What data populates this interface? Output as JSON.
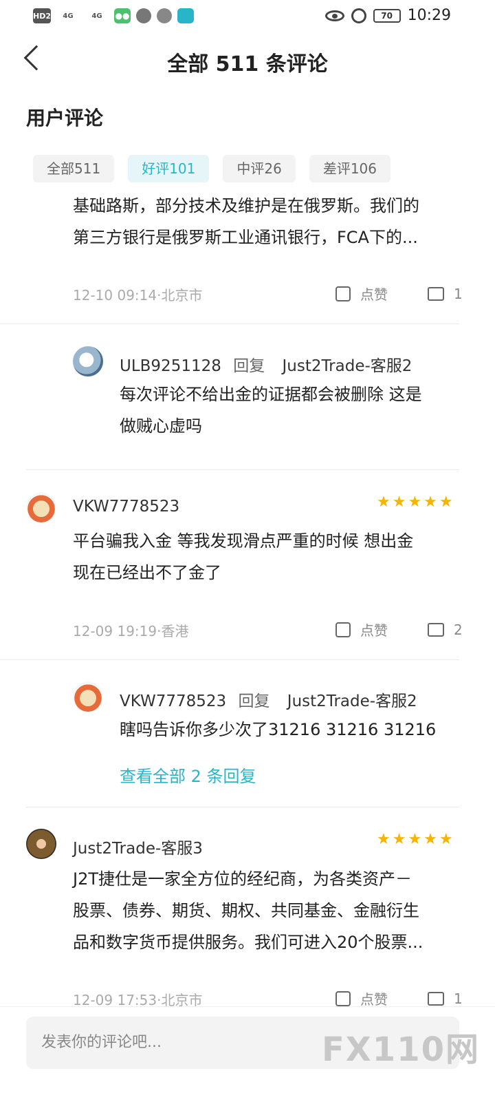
{
  "status_bar": {
    "left": {
      "hd": "HD2",
      "sig1": "4G",
      "sig2": "4G"
    },
    "battery": "70",
    "time": "10:29"
  },
  "header": {
    "title": "全部 511 条评论"
  },
  "section": {
    "title": "用户评论"
  },
  "tabs": [
    {
      "label": "全部511"
    },
    {
      "label": "好评101",
      "active": true
    },
    {
      "label": "中评26"
    },
    {
      "label": "差评106"
    }
  ],
  "comment0": {
    "text_line1": "基础路斯，部分技术及维护是在俄罗斯。我们的",
    "text_line2": "第三方银行是俄罗斯工业通讯银行，FCA下的...",
    "meta": "12-10 09:14·北京市",
    "like_label": "点赞",
    "reply_count": "1"
  },
  "reply1": {
    "user": "ULB9251128",
    "reply_word": "回复",
    "target": "Just2Trade-客服2",
    "text_line1": "每次评论不给出金的证据都会被删除 这是",
    "text_line2": "做贼心虚吗"
  },
  "comment1": {
    "user": "VKW7778523",
    "stars": "★★★★★",
    "text_line1": "平台骗我入金 等我发现滑点严重的时候 想出金",
    "text_line2": "现在已经出不了金了",
    "meta": "12-09 19:19·香港",
    "like_label": "点赞",
    "reply_count": "2"
  },
  "reply2": {
    "user": "VKW7778523",
    "reply_word": "回复",
    "target": "Just2Trade-客服2",
    "text_line1": "瞎吗告诉你多少次了31216  31216 31216",
    "view_all": "查看全部 2 条回复"
  },
  "comment2": {
    "user": "Just2Trade-客服3",
    "stars": "★★★★★",
    "text_line1": "J2T捷仕是一家全方位的经纪商，为各类资产－",
    "text_line2": "股票、债券、期货、期权、共同基金、金融衍生",
    "text_line3": "品和数字货币提供服务。我们可进入20个股票...",
    "meta": "12-09 17:53·北京市",
    "like_label": "点赞",
    "reply_count": "1"
  },
  "input": {
    "placeholder": "发表你的评论吧..."
  },
  "watermark": "FX110网"
}
